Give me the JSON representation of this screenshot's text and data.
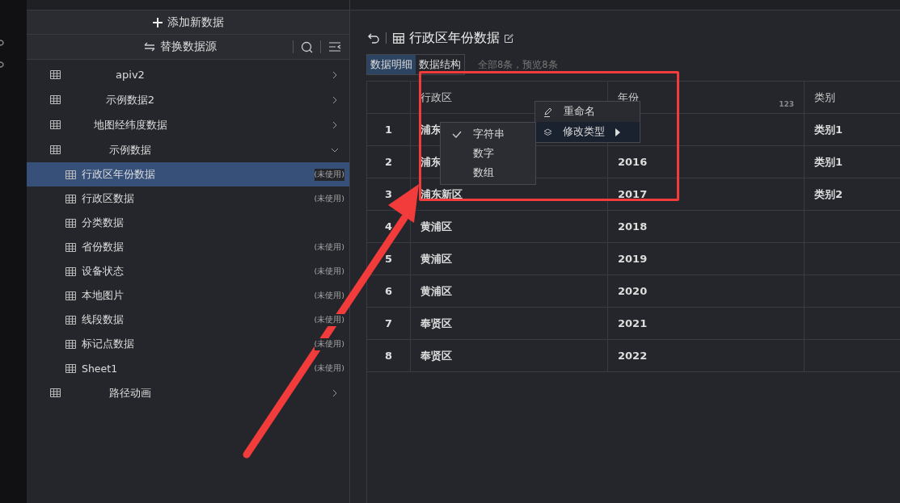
{
  "sidebar": {
    "add_button": "添加新数据",
    "replace_button": "替换数据源",
    "tree": [
      {
        "label": "apiv2",
        "expanded": false
      },
      {
        "label": "示例数据2",
        "expanded": false
      },
      {
        "label": "地图经纬度数据",
        "expanded": false
      },
      {
        "label": "示例数据",
        "expanded": true,
        "children": [
          {
            "label": "行政区年份数据",
            "status": "(未使用)",
            "selected": true
          },
          {
            "label": "行政区数据",
            "status": "(未使用)",
            "selected": false
          },
          {
            "label": "分类数据",
            "selected": false
          },
          {
            "label": "省份数据",
            "status": "(未使用)",
            "selected": false
          },
          {
            "label": "设备状态",
            "status": "(未使用)",
            "selected": false
          },
          {
            "label": "本地图片",
            "status": "(未使用)",
            "selected": false
          },
          {
            "label": "线段数据",
            "status": "(未使用)",
            "selected": false
          },
          {
            "label": "标记点数据",
            "status": "(未使用)",
            "selected": false
          },
          {
            "label": "Sheet1",
            "status": "(未使用)",
            "selected": false
          }
        ]
      },
      {
        "label": "路径动画",
        "expanded": false
      }
    ]
  },
  "main": {
    "title": "行政区年份数据",
    "tabs": [
      {
        "label": "数据明细",
        "selected": true
      },
      {
        "label": "数据结构",
        "selected": false
      }
    ],
    "summary": "全部8条，预览8条",
    "table": {
      "columns": [
        {
          "label": "行政区"
        },
        {
          "label": "年份",
          "type_badge": "123"
        },
        {
          "label": "类别"
        }
      ],
      "rows": [
        {
          "index": "1",
          "cells": [
            "浦东",
            null,
            "类别1"
          ]
        },
        {
          "index": "2",
          "cells": [
            "浦东",
            "2016",
            "类别1"
          ]
        },
        {
          "index": "3",
          "cells": [
            "浦东新区",
            "2017",
            "类别2"
          ]
        },
        {
          "index": "4",
          "cells": [
            "黄浦区",
            "2018",
            null
          ]
        },
        {
          "index": "5",
          "cells": [
            "黄浦区",
            "2019",
            null
          ]
        },
        {
          "index": "6",
          "cells": [
            "黄浦区",
            "2020",
            null
          ]
        },
        {
          "index": "7",
          "cells": [
            "奉贤区",
            "2021",
            null
          ]
        },
        {
          "index": "8",
          "cells": [
            "奉贤区",
            "2022",
            null
          ]
        }
      ]
    }
  },
  "context_menu": {
    "items": [
      {
        "label": "重命名",
        "kind": "rename",
        "highlighted": false
      },
      {
        "label": "修改类型",
        "kind": "submenu",
        "highlighted": true
      }
    ],
    "submenu": [
      {
        "label": "字符串",
        "checked": true
      },
      {
        "label": "数字",
        "checked": false
      },
      {
        "label": "数组",
        "checked": false
      }
    ]
  }
}
